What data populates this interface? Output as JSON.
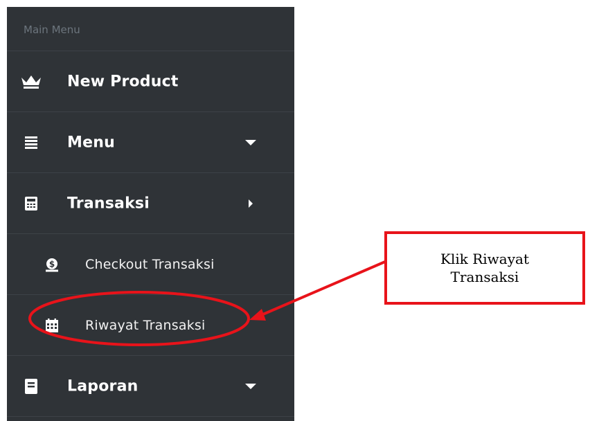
{
  "sidebar": {
    "header": "Main Menu",
    "items": [
      {
        "label": "New Product",
        "icon": "crown-icon"
      },
      {
        "label": "Menu",
        "icon": "list-icon",
        "caret": "down"
      },
      {
        "label": "Transaksi",
        "icon": "calculator-icon",
        "caret": "right"
      },
      {
        "label": "Checkout Transaksi",
        "icon": "money-bag-icon",
        "sub": true
      },
      {
        "label": "Riwayat Transaksi",
        "icon": "calendar-icon",
        "sub": true
      },
      {
        "label": "Laporan",
        "icon": "book-icon",
        "caret": "down"
      }
    ]
  },
  "annotation": {
    "callout_text": "Klik Riwayat Transaksi",
    "color": "#e8131a"
  }
}
